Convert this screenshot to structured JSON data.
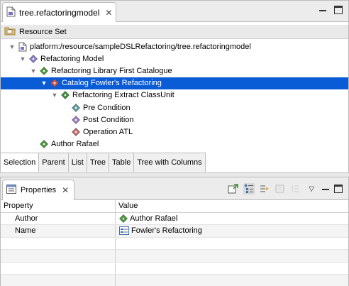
{
  "editor": {
    "tab_label": "tree.refactoringmodel",
    "tab_close": "✕",
    "resource_set_label": "Resource Set",
    "tree": [
      {
        "label": "platform:/resource/sampleDSLRefactoring/tree.refactoringmodel",
        "depth": 0,
        "expanded": true,
        "icon": "file-icon"
      },
      {
        "label": "Refactoring Model",
        "depth": 1,
        "expanded": true,
        "icon": "model-icon"
      },
      {
        "label": "Refactoring Library First Catalogue",
        "depth": 2,
        "expanded": true,
        "icon": "library-icon"
      },
      {
        "label": "Catalog Fowler's Refactoring",
        "depth": 3,
        "expanded": true,
        "icon": "catalog-icon",
        "selected": true
      },
      {
        "label": "Refactoring Extract ClassUnit",
        "depth": 4,
        "expanded": true,
        "icon": "refactoring-icon"
      },
      {
        "label": "Pre Condition",
        "depth": 5,
        "icon": "precondition-icon"
      },
      {
        "label": "Post Condition",
        "depth": 5,
        "icon": "postcondition-icon"
      },
      {
        "label": "Operation ATL",
        "depth": 5,
        "icon": "operation-icon"
      },
      {
        "label": "Author Rafael",
        "depth": 2,
        "icon": "author-icon"
      }
    ],
    "bottom_tabs": [
      "Selection",
      "Parent",
      "List",
      "Tree",
      "Table",
      "Tree with Columns"
    ],
    "active_bottom_tab": "Selection"
  },
  "properties": {
    "tab_label": "Properties",
    "tab_close": "✕",
    "dropdown_glyph": "▽",
    "columns": [
      "Property",
      "Value"
    ],
    "rows": [
      {
        "property": "Author",
        "value": "Author Rafael",
        "icon": "author-icon"
      },
      {
        "property": "Name",
        "value": "Fowler's Refactoring",
        "icon": "text-field-icon"
      }
    ]
  },
  "colors": {
    "selection": "#0a5bd6",
    "author_green": "#4a9a3a",
    "catalog_red": "#d9534f",
    "model_purple": "#8a7fd0"
  }
}
